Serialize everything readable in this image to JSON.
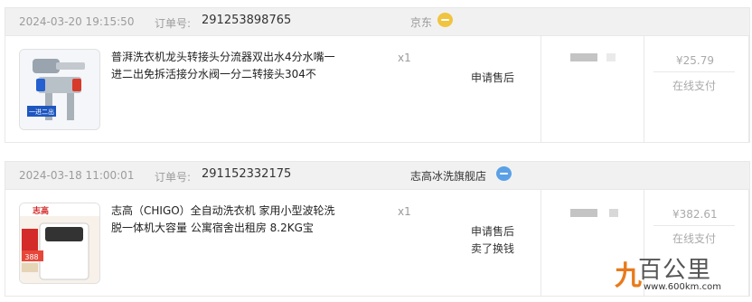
{
  "orders": [
    {
      "date": "2024-03-20 19:15:50",
      "order_no_label": "订单号:",
      "order_no": "291253898765",
      "shop": "京东",
      "shop_color": "#9a9a9a",
      "chat_icon_color": "#f0c440",
      "title": "普湃洗衣机龙头转接头分流器双出水4分水嘴一进二出免拆活接分水阀一分二转接头304不",
      "qty": "x1",
      "after_sale": [
        "申请售后"
      ],
      "price": "¥25.79",
      "pay_method": "在线支付",
      "image_badge": "一进二出"
    },
    {
      "date": "2024-03-18 11:00:01",
      "order_no_label": "订单号:",
      "order_no": "291152332175",
      "shop": "志高冰洗旗舰店",
      "shop_color": "#333333",
      "chat_icon_color": "#5aa0e6",
      "title": "志高（CHIGO）全自动洗衣机 家用小型波轮洗脱一体机大容量 公寓宿舍出租房 8.2KG宝",
      "qty": "x1",
      "after_sale": [
        "申请售后",
        "卖了换钱"
      ],
      "price": "¥382.61",
      "pay_method": "在线支付",
      "image_badge": "志高",
      "image_price": "388"
    }
  ],
  "watermark": {
    "nine": "九",
    "main": "百公里",
    "url": "www.600km.com"
  }
}
